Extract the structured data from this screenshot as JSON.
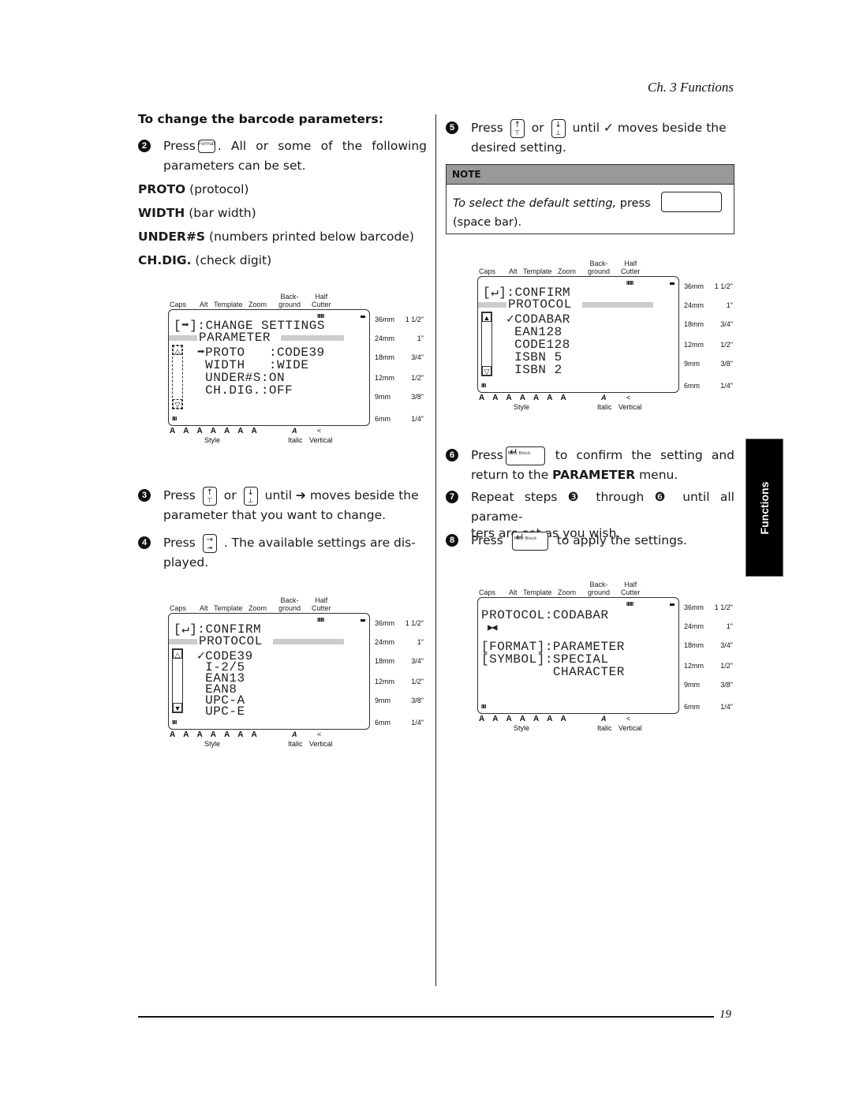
{
  "header": {
    "chapter": "Ch. 3 Functions"
  },
  "side_tab": {
    "label": "Functions"
  },
  "footer": {
    "page_number": "19"
  },
  "left": {
    "section_title": "To change the barcode parameters:",
    "step2": {
      "num": "2",
      "pre": "Press",
      "key_label": "Format",
      "post": ". All or some of the following",
      "line2": "parameters can be set."
    },
    "params": [
      {
        "name": "PROTO",
        "desc": " (protocol)"
      },
      {
        "name": "WIDTH",
        "desc": " (bar width)"
      },
      {
        "name": "UNDER#S",
        "desc": " (numbers printed below barcode)"
      },
      {
        "name": "CH.DIG.",
        "desc": " (check digit)"
      }
    ],
    "step3": {
      "num": "3",
      "pre": "Press",
      "or": "or",
      "post": "until ➔ moves beside the",
      "line2": "parameter that you want to change."
    },
    "step4": {
      "num": "4",
      "pre": "Press",
      "post": ". The available settings are dis-",
      "line2": "played."
    }
  },
  "right": {
    "step5": {
      "num": "5",
      "pre": "Press",
      "or": "or",
      "post": "until ✓ moves beside the",
      "line2": "desired setting."
    },
    "note": {
      "title": "NOTE",
      "italic": "To select the default setting,",
      "press": "press",
      "line2": "(space bar)."
    },
    "step6": {
      "num": "6",
      "pre": "Press",
      "key_label": "New Block",
      "post": "to confirm the setting and",
      "line2_pre": "return to the ",
      "line2_bold": "PARAMETER",
      "line2_post": " menu."
    },
    "step7": {
      "num": "7",
      "line1": "Repeat steps ❸ through ❻ until all parame-",
      "line2": "ters are set as you wish."
    },
    "step8": {
      "num": "8",
      "pre": "Press",
      "key_label": "New Block",
      "post": "to apply the settings."
    }
  },
  "lcd_common": {
    "top_labels": {
      "caps": "Caps",
      "alt": "Alt",
      "template": "Template",
      "zoom": "Zoom",
      "back": "Back-",
      "ground": "ground",
      "half": "Half",
      "cutter": "Cutter"
    },
    "tape_sizes": [
      {
        "mm": "36mm",
        "inch": "1 1/2\""
      },
      {
        "mm": "24mm",
        "inch": "1\""
      },
      {
        "mm": "18mm",
        "inch": "3/4\""
      },
      {
        "mm": "12mm",
        "inch": "1/2\""
      },
      {
        "mm": "9mm",
        "inch": "3/8\""
      },
      {
        "mm": "6mm",
        "inch": "1/4\""
      }
    ],
    "style_glyphs": "A A A A A A A",
    "style_label": "Style",
    "italic_glyph": "A",
    "italic_label": "Italic",
    "vertical_glyph": "<",
    "vertical_label": "Vertical",
    "bars_top": "IIIIII",
    "bars_bottom": "IIII"
  },
  "lcd1": {
    "lines": [
      "[➡]:CHANGE SETTINGS",
      "PARAMETER",
      "➡PROTO   :CODE39",
      " WIDTH   :WIDE",
      " UNDER#S:ON",
      " CH.DIG.:OFF"
    ]
  },
  "lcd2": {
    "lines": [
      "[↵]:CONFIRM",
      "PROTOCOL",
      "✓CODE39",
      " I-2/5",
      " EAN13",
      " EAN8",
      " UPC-A",
      " UPC-E"
    ]
  },
  "lcd3": {
    "lines": [
      "[↵]:CONFIRM",
      "PROTOCOL",
      "✓CODABAR",
      " EAN128",
      " CODE128",
      " ISBN 5",
      " ISBN 2"
    ]
  },
  "lcd4": {
    "lines": [
      "PROTOCOL:CODABAR",
      "▶◀",
      "[FORMAT]:PARAMETER",
      "[SYMBOL]:SPECIAL",
      "         CHARACTER"
    ]
  }
}
